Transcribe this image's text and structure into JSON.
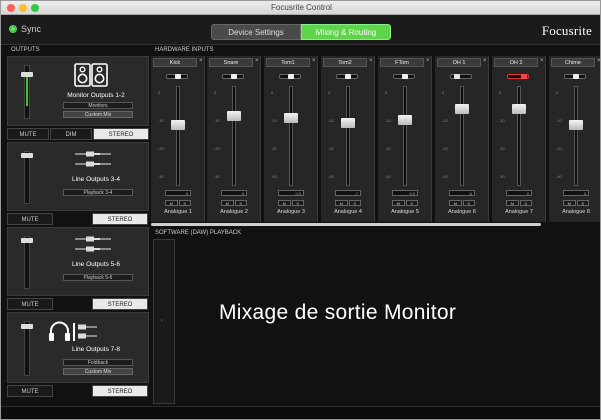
{
  "window": {
    "title": "Focusrite Control"
  },
  "toolbar": {
    "sync_label": "Sync",
    "tab_device": "Device Settings",
    "tab_mixing": "Mixing & Routing",
    "brand": "Focusrite",
    "active_tab_color": "#5ed44a"
  },
  "outputs": {
    "header": "OUTPUTS",
    "blocks": [
      {
        "name": "Monitor Outputs 1-2",
        "sub1": "Monitors",
        "sub2": "Custom Mix",
        "fader_level": 0.85,
        "buttons": [
          "MUTE",
          "DIM",
          "STEREO"
        ],
        "icon": "monitor-speakers-icon"
      },
      {
        "name": "Line Outputs 3-4",
        "sub1": "Playback 3-4",
        "fader_level": 0.95,
        "buttons": [
          "MUTE",
          "STEREO"
        ],
        "icon": "cable-plugs-icon"
      },
      {
        "name": "Line Outputs 5-6",
        "sub1": "Playback 5-6",
        "fader_level": 0.95,
        "buttons": [
          "MUTE",
          "STEREO"
        ],
        "icon": "cable-plugs-icon"
      },
      {
        "name": "Line Outputs 7-8",
        "sub1": "Foldback",
        "sub2": "Custom Mix",
        "fader_level": 0.95,
        "buttons": [
          "MUTE",
          "STEREO"
        ],
        "icon": "headphones-icon"
      }
    ]
  },
  "hardware_inputs": {
    "header": "HARDWARE INPUTS",
    "scale": [
      "0",
      "-10",
      "-20",
      "-40"
    ],
    "channels": [
      {
        "name": "Kick",
        "input": "Analogue 1",
        "level": 0.62,
        "pan": 0.5,
        "gain": "0"
      },
      {
        "name": "Snare",
        "input": "Analogue 2",
        "level": 0.72,
        "pan": 0.5,
        "gain": "0"
      },
      {
        "name": "Tom1",
        "input": "Analogue 3",
        "level": 0.7,
        "pan": 0.5,
        "gain": "0.0"
      },
      {
        "name": "Tom2",
        "input": "Analogue 4",
        "level": 0.65,
        "pan": 0.5,
        "gain": "-7"
      },
      {
        "name": "FTom",
        "input": "Analogue 5",
        "level": 0.68,
        "pan": 0.5,
        "gain": "0.0"
      },
      {
        "name": "OH 1",
        "input": "Analogue 6",
        "level": 0.8,
        "pan": 0.2,
        "gain": "-6"
      },
      {
        "name": "OH 2",
        "input": "Analogue 7",
        "level": 0.8,
        "pan": 0.8,
        "gain": "0"
      },
      {
        "name": "Chime",
        "input": "Analogue 8",
        "level": 0.62,
        "pan": 0.5,
        "gain": "0"
      }
    ],
    "ms_labels": [
      "M",
      "S"
    ]
  },
  "software_playback": {
    "header": "SOFTWARE (DAW) PLAYBACK",
    "arrow": "‹"
  },
  "caption": "Mixage de sortie Monitor"
}
